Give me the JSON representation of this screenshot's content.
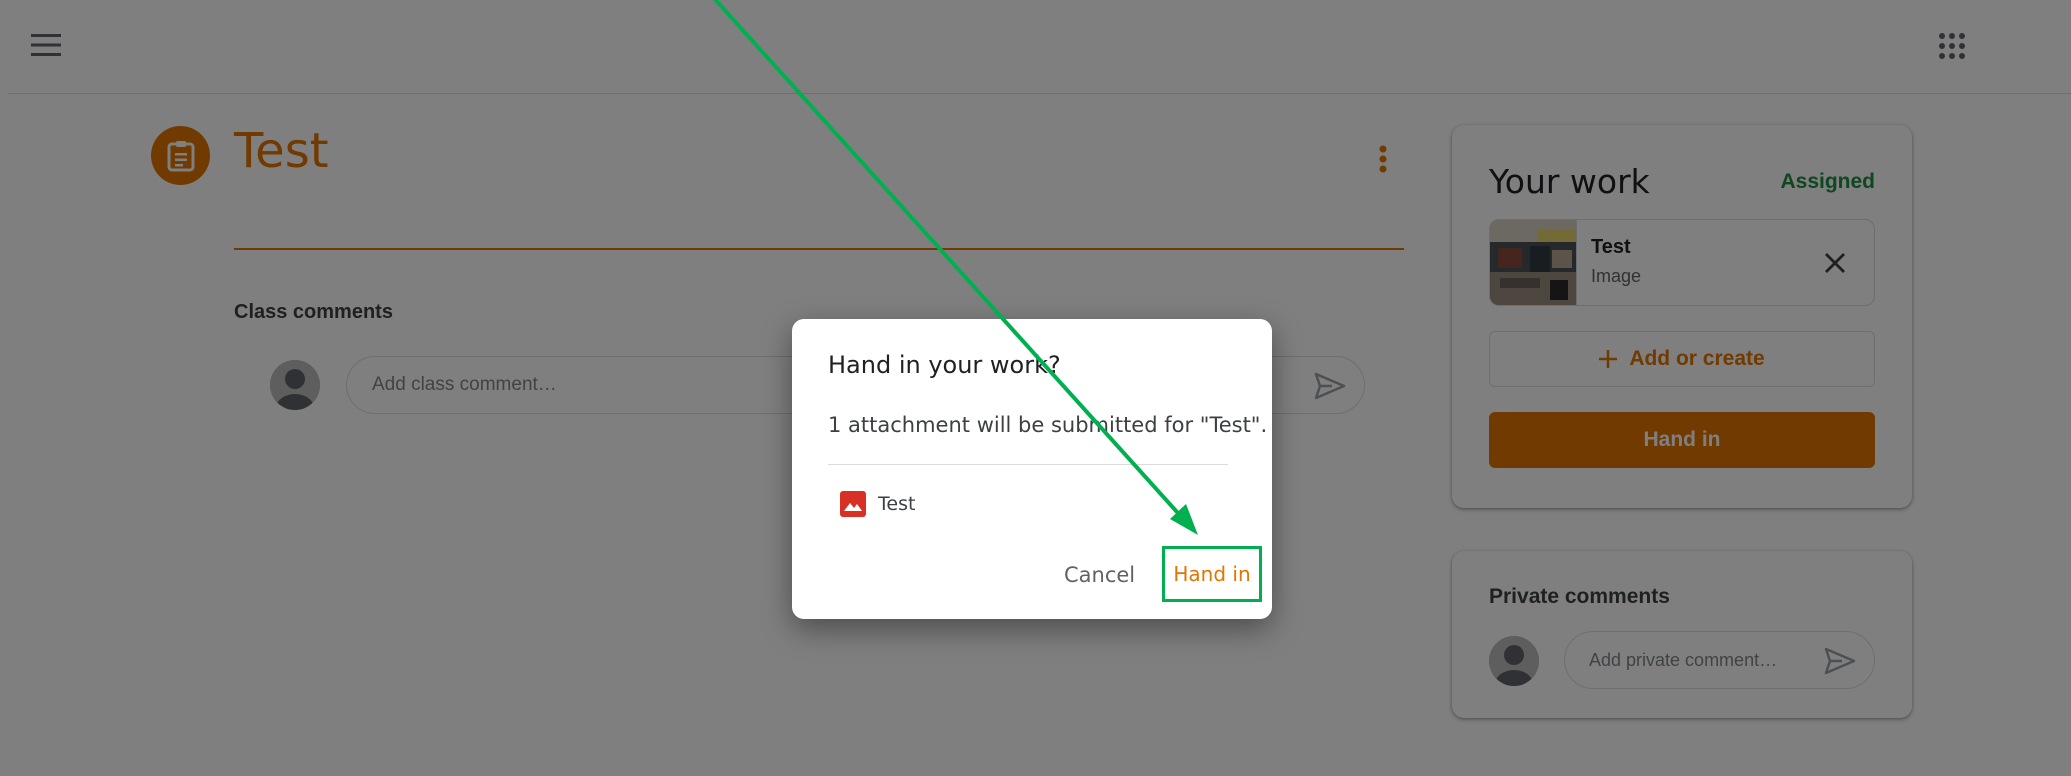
{
  "header": {
    "menu_icon": "hamburger-menu-icon",
    "apps_icon": "apps-grid-icon"
  },
  "assignment": {
    "title": "Test",
    "icon": "assignment-clipboard-icon",
    "accent_color": "#e37400"
  },
  "class_comments": {
    "title": "Class comments",
    "placeholder": "Add class comment…",
    "send_icon": "send-icon"
  },
  "your_work": {
    "title": "Your work",
    "status": "Assigned",
    "status_color": "#1e8e3e",
    "attachment": {
      "name": "Test",
      "type": "Image",
      "remove_icon": "close-icon"
    },
    "add_label": "Add or create",
    "hand_in_label": "Hand in"
  },
  "private_comments": {
    "title": "Private comments",
    "placeholder": "Add private comment…",
    "send_icon": "send-icon"
  },
  "dialog": {
    "title": "Hand in your work?",
    "message": "1 attachment will be submitted for \"Test\".",
    "item_name": "Test",
    "item_icon": "image-file-icon",
    "cancel_label": "Cancel",
    "confirm_label": "Hand in",
    "highlight_color": "#00b050"
  }
}
